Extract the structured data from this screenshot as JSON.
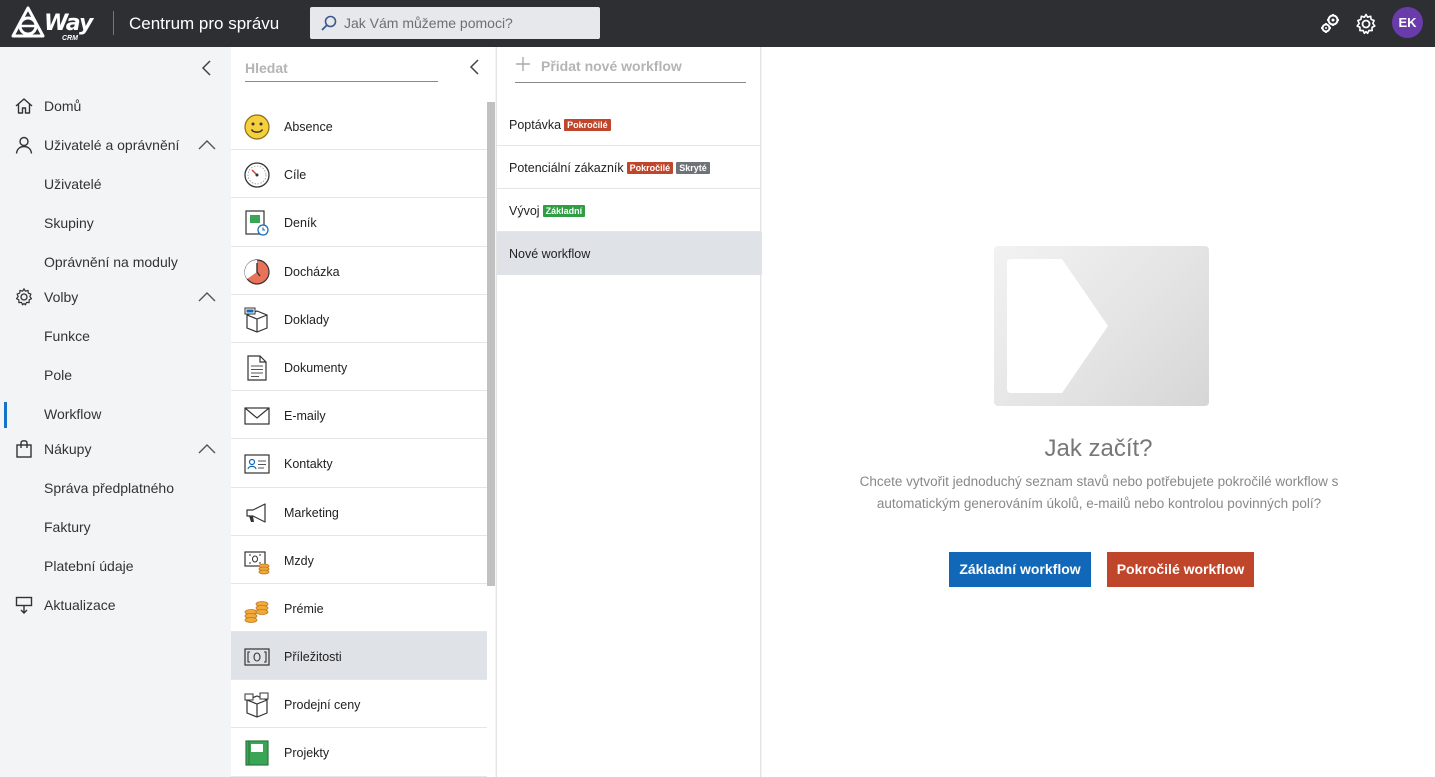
{
  "topbar": {
    "logo_text": "Way",
    "logo_sub": "CRM",
    "app_title": "Centrum pro správu",
    "search_placeholder": "Jak Vám můžeme pomoci?",
    "avatar_initials": "EK",
    "icons": [
      "plugins-icon",
      "settings-icon"
    ]
  },
  "sidebar": {
    "items": [
      {
        "label": "Domů",
        "icon": "home-icon"
      },
      {
        "label": "Uživatelé a oprávnění",
        "icon": "user-icon",
        "expanded": true,
        "children": [
          "Uživatelé",
          "Skupiny",
          "Oprávnění na moduly"
        ]
      },
      {
        "label": "Volby",
        "icon": "gear-icon",
        "expanded": true,
        "children": [
          "Funkce",
          "Pole",
          "Workflow"
        ]
      },
      {
        "label": "Nákupy",
        "icon": "bag-icon",
        "expanded": true,
        "children": [
          "Správa předplatného",
          "Faktury",
          "Platební údaje"
        ]
      },
      {
        "label": "Aktualizace",
        "icon": "update-icon"
      }
    ],
    "active": "Workflow"
  },
  "modules": {
    "search_placeholder": "Hledat",
    "items": [
      {
        "label": "Absence",
        "icon": "smiley-icon"
      },
      {
        "label": "Cíle",
        "icon": "target-icon"
      },
      {
        "label": "Deník",
        "icon": "journal-icon"
      },
      {
        "label": "Docházka",
        "icon": "clock-icon"
      },
      {
        "label": "Doklady",
        "icon": "box-icon"
      },
      {
        "label": "Dokumenty",
        "icon": "document-icon"
      },
      {
        "label": "E-maily",
        "icon": "envelope-icon"
      },
      {
        "label": "Kontakty",
        "icon": "contact-card-icon"
      },
      {
        "label": "Marketing",
        "icon": "megaphone-icon"
      },
      {
        "label": "Mzdy",
        "icon": "wage-icon"
      },
      {
        "label": "Prémie",
        "icon": "coins-icon"
      },
      {
        "label": "Příležitosti",
        "icon": "opportunity-icon"
      },
      {
        "label": "Prodejní ceny",
        "icon": "price-box-icon"
      },
      {
        "label": "Projekty",
        "icon": "project-icon"
      }
    ],
    "selected": "Příležitosti"
  },
  "workflows": {
    "add_label": "Přidat nové workflow",
    "items": [
      {
        "label": "Poptávka",
        "badges": [
          {
            "text": "Pokročilé",
            "type": "adv"
          }
        ]
      },
      {
        "label": "Potenciální zákazník",
        "badges": [
          {
            "text": "Pokročilé",
            "type": "adv"
          },
          {
            "text": "Skryté",
            "type": "hid"
          }
        ]
      },
      {
        "label": "Vývoj",
        "badges": [
          {
            "text": "Základní",
            "type": "basic"
          }
        ]
      },
      {
        "label": "Nové workflow",
        "badges": []
      }
    ],
    "selected": "Nové workflow"
  },
  "empty_state": {
    "title": "Jak začít?",
    "description": "Chcete vytvořit jednoduchý seznam stavů nebo potřebujete pokročilé workflow s automatickým generováním úkolů, e-mailů nebo kontrolou povinných polí?",
    "basic_button": "Základní workflow",
    "advanced_button": "Pokročilé workflow"
  },
  "colors": {
    "topbar": "#2d2f33",
    "primary": "#1268b8",
    "advanced": "#c0462b",
    "basic_badge": "#2f9e44",
    "hidden_badge": "#6f7378",
    "avatar": "#6a3bab"
  }
}
